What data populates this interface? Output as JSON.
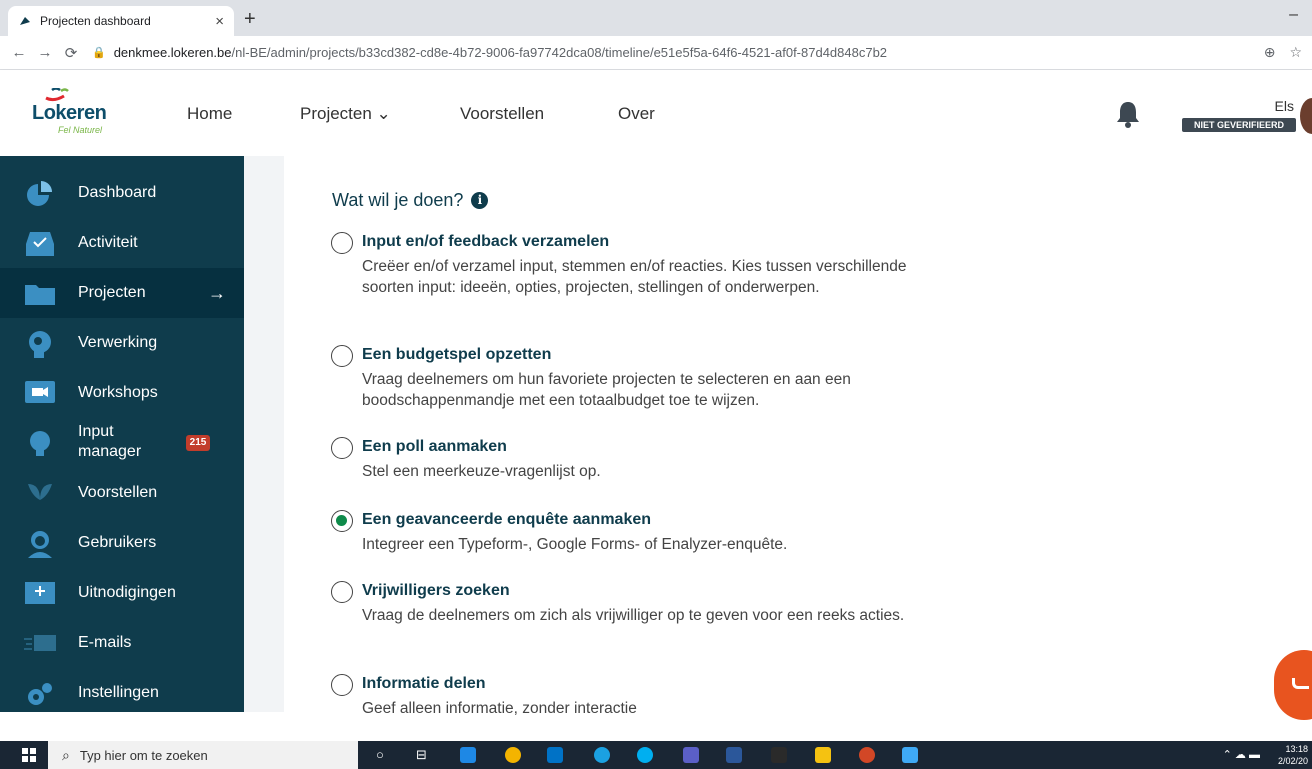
{
  "browser": {
    "tab_title": "Projecten dashboard",
    "tab_close": "×",
    "new_tab": "+",
    "minimize": "–",
    "url_domain": "denkmee.lokeren.be",
    "url_path": "/nl-BE/admin/projects/b33cd382-cd8e-4b72-9006-fa97742dca08/timeline/e51e5f5a-64f6-4521-af0f-87d4d848c7b2"
  },
  "header": {
    "logo_text": "Lokeren",
    "logo_sub": "Fel Naturel",
    "nav": [
      {
        "label": "Home"
      },
      {
        "label": "Projecten ⌄"
      },
      {
        "label": "Voorstellen"
      },
      {
        "label": "Over"
      }
    ],
    "user_name": "Els",
    "user_badge": "NIET GEVERIFIEERD"
  },
  "sidebar": {
    "items": [
      {
        "label": "Dashboard",
        "icon": "pie-chart-icon"
      },
      {
        "label": "Activiteit",
        "icon": "inbox-check-icon"
      },
      {
        "label": "Projecten",
        "icon": "folder-icon",
        "active": true,
        "arrow": "→"
      },
      {
        "label": "Verwerking",
        "icon": "head-gear-icon"
      },
      {
        "label": "Workshops",
        "icon": "video-icon"
      },
      {
        "label": "Input",
        "label2": "manager",
        "icon": "lightbulb-icon",
        "badge": "215"
      },
      {
        "label": "Voorstellen",
        "icon": "leaf-icon"
      },
      {
        "label": "Gebruikers",
        "icon": "user-icon"
      },
      {
        "label": "Uitnodigingen",
        "icon": "envelope-plus-icon"
      },
      {
        "label": "E-mails",
        "icon": "send-mail-icon"
      },
      {
        "label": "Instellingen",
        "icon": "gears-icon"
      }
    ]
  },
  "main": {
    "question": "Wat wil je doen?",
    "info_glyph": "i",
    "options": [
      {
        "title": "Input en/of feedback verzamelen",
        "desc": "Creëer en/of verzamel input, stemmen en/of reacties. Kies tussen verschillende soorten input: ideeën, opties, projecten, stellingen of onderwerpen.",
        "checked": false
      },
      {
        "title": "Een budgetspel opzetten",
        "desc": "Vraag deelnemers om hun favoriete projecten te selecteren en aan een boodschappenmandje met een totaalbudget toe te wijzen.",
        "checked": false
      },
      {
        "title": "Een poll aanmaken",
        "desc": "Stel een meerkeuze-vragenlijst op.",
        "checked": false
      },
      {
        "title": "Een geavanceerde enquête aanmaken",
        "desc": "Integreer een Typeform-, Google Forms- of Enalyzer-enquête.",
        "checked": true
      },
      {
        "title": "Vrijwilligers zoeken",
        "desc": "Vraag de deelnemers om zich als vrijwilliger op te geven voor een reeks acties.",
        "checked": false
      },
      {
        "title": "Informatie delen",
        "desc": "Geef alleen informatie, zonder interactie",
        "checked": false
      }
    ]
  },
  "taskbar": {
    "search_placeholder": "Typ hier om te zoeken",
    "time": "13:18",
    "date": "2/02/20"
  }
}
